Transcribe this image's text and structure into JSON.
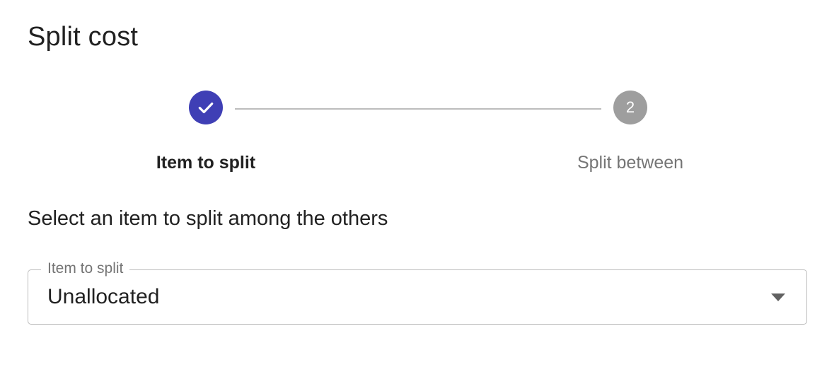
{
  "dialog": {
    "title": "Split cost"
  },
  "stepper": {
    "steps": [
      {
        "label": "Item to split",
        "status": "completed",
        "icon": "check-icon"
      },
      {
        "label": "Split between",
        "status": "pending",
        "number": "2"
      }
    ]
  },
  "instruction": "Select an item to split among the others",
  "item_select": {
    "label": "Item to split",
    "value": "Unallocated",
    "icon": "dropdown-arrow-icon"
  },
  "colors": {
    "accent": "#3f3fb5",
    "pending": "#9e9e9e",
    "text": "#212121",
    "muted": "#757575"
  }
}
